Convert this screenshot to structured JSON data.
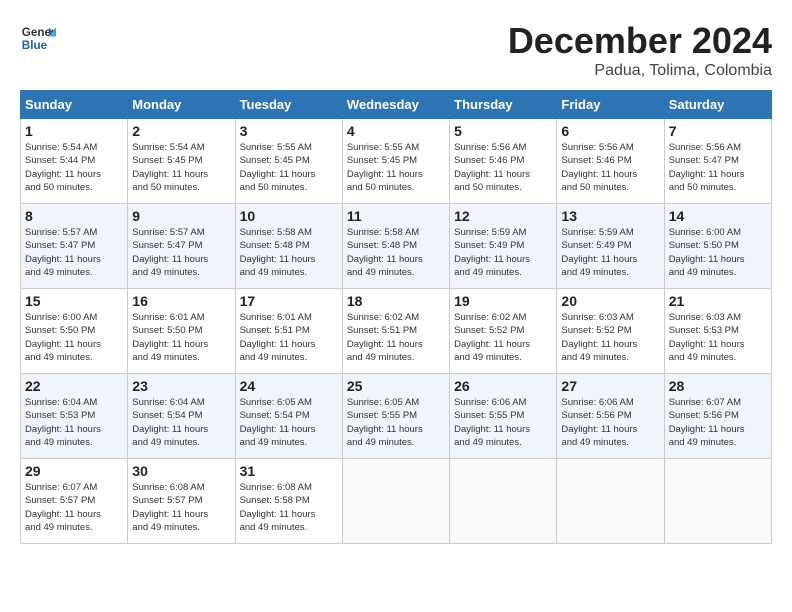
{
  "logo": {
    "line1": "General",
    "line2": "Blue"
  },
  "title": "December 2024",
  "location": "Padua, Tolima, Colombia",
  "days_of_week": [
    "Sunday",
    "Monday",
    "Tuesday",
    "Wednesday",
    "Thursday",
    "Friday",
    "Saturday"
  ],
  "weeks": [
    [
      {
        "day": "1",
        "info": "Sunrise: 5:54 AM\nSunset: 5:44 PM\nDaylight: 11 hours\nand 50 minutes."
      },
      {
        "day": "2",
        "info": "Sunrise: 5:54 AM\nSunset: 5:45 PM\nDaylight: 11 hours\nand 50 minutes."
      },
      {
        "day": "3",
        "info": "Sunrise: 5:55 AM\nSunset: 5:45 PM\nDaylight: 11 hours\nand 50 minutes."
      },
      {
        "day": "4",
        "info": "Sunrise: 5:55 AM\nSunset: 5:45 PM\nDaylight: 11 hours\nand 50 minutes."
      },
      {
        "day": "5",
        "info": "Sunrise: 5:56 AM\nSunset: 5:46 PM\nDaylight: 11 hours\nand 50 minutes."
      },
      {
        "day": "6",
        "info": "Sunrise: 5:56 AM\nSunset: 5:46 PM\nDaylight: 11 hours\nand 50 minutes."
      },
      {
        "day": "7",
        "info": "Sunrise: 5:56 AM\nSunset: 5:47 PM\nDaylight: 11 hours\nand 50 minutes."
      }
    ],
    [
      {
        "day": "8",
        "info": "Sunrise: 5:57 AM\nSunset: 5:47 PM\nDaylight: 11 hours\nand 49 minutes."
      },
      {
        "day": "9",
        "info": "Sunrise: 5:57 AM\nSunset: 5:47 PM\nDaylight: 11 hours\nand 49 minutes."
      },
      {
        "day": "10",
        "info": "Sunrise: 5:58 AM\nSunset: 5:48 PM\nDaylight: 11 hours\nand 49 minutes."
      },
      {
        "day": "11",
        "info": "Sunrise: 5:58 AM\nSunset: 5:48 PM\nDaylight: 11 hours\nand 49 minutes."
      },
      {
        "day": "12",
        "info": "Sunrise: 5:59 AM\nSunset: 5:49 PM\nDaylight: 11 hours\nand 49 minutes."
      },
      {
        "day": "13",
        "info": "Sunrise: 5:59 AM\nSunset: 5:49 PM\nDaylight: 11 hours\nand 49 minutes."
      },
      {
        "day": "14",
        "info": "Sunrise: 6:00 AM\nSunset: 5:50 PM\nDaylight: 11 hours\nand 49 minutes."
      }
    ],
    [
      {
        "day": "15",
        "info": "Sunrise: 6:00 AM\nSunset: 5:50 PM\nDaylight: 11 hours\nand 49 minutes."
      },
      {
        "day": "16",
        "info": "Sunrise: 6:01 AM\nSunset: 5:50 PM\nDaylight: 11 hours\nand 49 minutes."
      },
      {
        "day": "17",
        "info": "Sunrise: 6:01 AM\nSunset: 5:51 PM\nDaylight: 11 hours\nand 49 minutes."
      },
      {
        "day": "18",
        "info": "Sunrise: 6:02 AM\nSunset: 5:51 PM\nDaylight: 11 hours\nand 49 minutes."
      },
      {
        "day": "19",
        "info": "Sunrise: 6:02 AM\nSunset: 5:52 PM\nDaylight: 11 hours\nand 49 minutes."
      },
      {
        "day": "20",
        "info": "Sunrise: 6:03 AM\nSunset: 5:52 PM\nDaylight: 11 hours\nand 49 minutes."
      },
      {
        "day": "21",
        "info": "Sunrise: 6:03 AM\nSunset: 5:53 PM\nDaylight: 11 hours\nand 49 minutes."
      }
    ],
    [
      {
        "day": "22",
        "info": "Sunrise: 6:04 AM\nSunset: 5:53 PM\nDaylight: 11 hours\nand 49 minutes."
      },
      {
        "day": "23",
        "info": "Sunrise: 6:04 AM\nSunset: 5:54 PM\nDaylight: 11 hours\nand 49 minutes."
      },
      {
        "day": "24",
        "info": "Sunrise: 6:05 AM\nSunset: 5:54 PM\nDaylight: 11 hours\nand 49 minutes."
      },
      {
        "day": "25",
        "info": "Sunrise: 6:05 AM\nSunset: 5:55 PM\nDaylight: 11 hours\nand 49 minutes."
      },
      {
        "day": "26",
        "info": "Sunrise: 6:06 AM\nSunset: 5:55 PM\nDaylight: 11 hours\nand 49 minutes."
      },
      {
        "day": "27",
        "info": "Sunrise: 6:06 AM\nSunset: 5:56 PM\nDaylight: 11 hours\nand 49 minutes."
      },
      {
        "day": "28",
        "info": "Sunrise: 6:07 AM\nSunset: 5:56 PM\nDaylight: 11 hours\nand 49 minutes."
      }
    ],
    [
      {
        "day": "29",
        "info": "Sunrise: 6:07 AM\nSunset: 5:57 PM\nDaylight: 11 hours\nand 49 minutes."
      },
      {
        "day": "30",
        "info": "Sunrise: 6:08 AM\nSunset: 5:57 PM\nDaylight: 11 hours\nand 49 minutes."
      },
      {
        "day": "31",
        "info": "Sunrise: 6:08 AM\nSunset: 5:58 PM\nDaylight: 11 hours\nand 49 minutes."
      },
      {
        "day": "",
        "info": ""
      },
      {
        "day": "",
        "info": ""
      },
      {
        "day": "",
        "info": ""
      },
      {
        "day": "",
        "info": ""
      }
    ]
  ]
}
